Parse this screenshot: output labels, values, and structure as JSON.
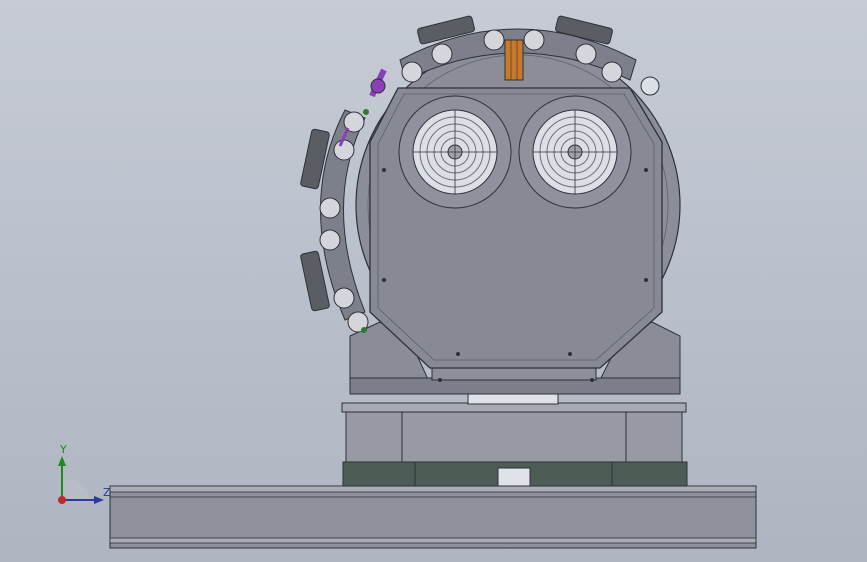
{
  "viewport": {
    "background_top": "#c6cbd5",
    "background_bottom": "#aeb5c1"
  },
  "colors": {
    "steel": "#8a8d98",
    "steel_dark": "#6f727d",
    "steel_light": "#a3a6b0",
    "edge": "#2e3038",
    "roller": "#d4d6dc",
    "accent_purple": "#8a3fb8",
    "accent_green": "#2f7a2f",
    "accent_copper": "#c87a2a",
    "plate_dark": "#4a5a52"
  },
  "triad": {
    "y_label": "Y",
    "z_label": "Z",
    "y_color": "#1c8a1c",
    "z_color": "#2a3a9a",
    "origin_color": "#c0282a"
  }
}
